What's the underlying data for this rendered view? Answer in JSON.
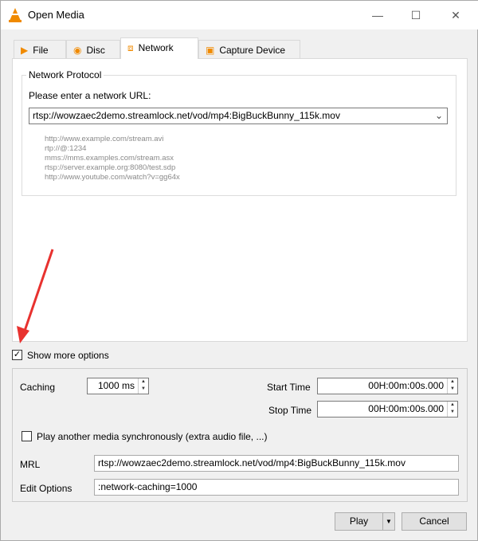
{
  "window": {
    "title": "Open Media",
    "minimize": "—",
    "maximize": "☐",
    "close": "✕",
    "accent": "#f08a00"
  },
  "tabs": [
    {
      "label": "File",
      "icon": "file-icon"
    },
    {
      "label": "Disc",
      "icon": "disc-icon"
    },
    {
      "label": "Network",
      "icon": "network-icon",
      "active": true
    },
    {
      "label": "Capture Device",
      "icon": "capture-device-icon"
    }
  ],
  "network": {
    "group_title": "Network Protocol",
    "prompt": "Please enter a network URL:",
    "url": "rtsp://wowzaec2demo.streamlock.net/vod/mp4:BigBuckBunny_115k.mov",
    "examples": [
      "http://www.example.com/stream.avi",
      "rtp://@:1234",
      "mms://mms.examples.com/stream.asx",
      "rtsp://server.example.org:8080/test.sdp",
      "http://www.youtube.com/watch?v=gg64x"
    ]
  },
  "show_more_options": {
    "label": "Show more options",
    "checked": true
  },
  "options": {
    "caching_label": "Caching",
    "caching_value": "1000 ms",
    "start_time_label": "Start Time",
    "start_time_value": "00H:00m:00s.000",
    "stop_time_label": "Stop Time",
    "stop_time_value": "00H:00m:00s.000",
    "sync_label": "Play another media synchronously (extra audio file, ...)",
    "sync_checked": false,
    "mrl_label": "MRL",
    "mrl_value": "rtsp://wowzaec2demo.streamlock.net/vod/mp4:BigBuckBunny_115k.mov",
    "edit_options_label": "Edit Options",
    "edit_options_value": ":network-caching=1000"
  },
  "buttons": {
    "play": "Play",
    "cancel": "Cancel"
  },
  "annotation_color": "#e8322f"
}
